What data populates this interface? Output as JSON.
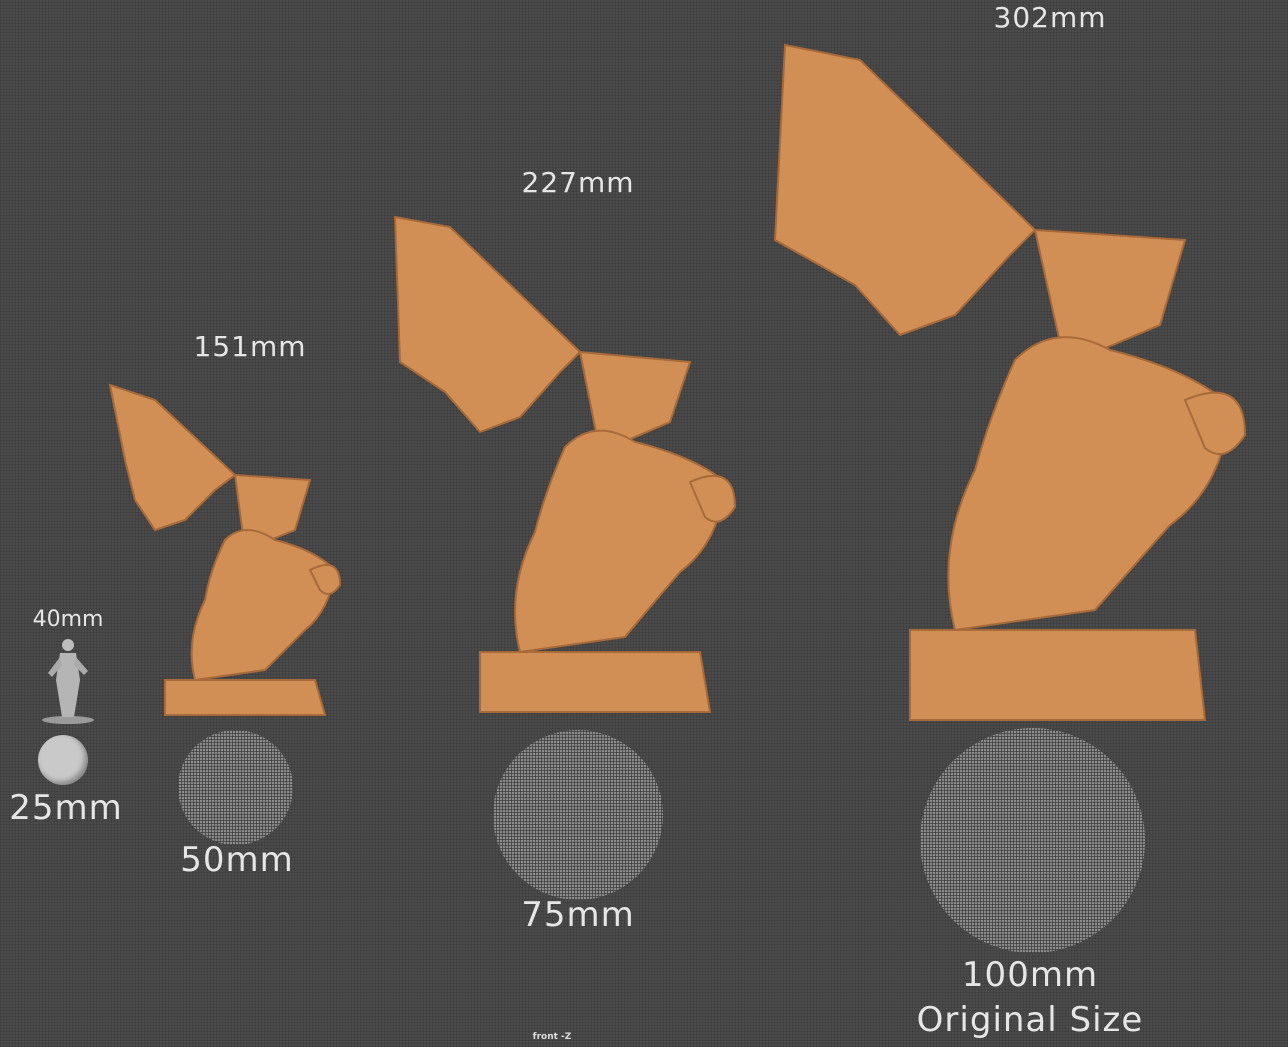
{
  "colors": {
    "background": "#4b4b4b",
    "model": "#d18f55",
    "model_shade": "#a86a38",
    "text": "#e6e6e6"
  },
  "reference": {
    "height_label": "40mm",
    "base_label": "25mm"
  },
  "figures": [
    {
      "height_label": "151mm",
      "base_label": "50mm"
    },
    {
      "height_label": "227mm",
      "base_label": "75mm"
    },
    {
      "height_label": "302mm",
      "base_label": "100mm",
      "note": "Original Size"
    }
  ],
  "viewport": {
    "view_label": "front -Z"
  }
}
